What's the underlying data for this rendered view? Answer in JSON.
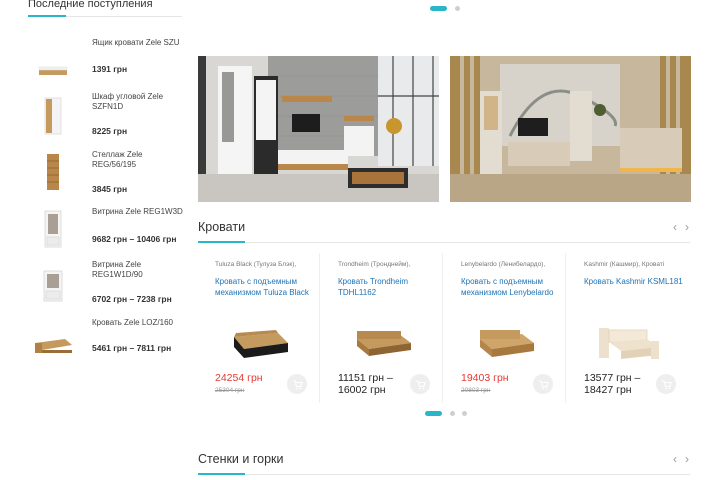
{
  "sidebar": {
    "title": "Последние поступления",
    "items": [
      {
        "name": "Ящик кровати Zele SZU",
        "price": "1391 грн",
        "thumb": "drawer"
      },
      {
        "name": "Шкаф угловой Zele SZFN1D",
        "price": "8225 грн",
        "thumb": "wardrobe"
      },
      {
        "name": "Стеллаж Zele REG/56/195",
        "price": "3845 грн",
        "thumb": "shelf"
      },
      {
        "name": "Витрина Zele REG1W3D",
        "price": "9682 грн – 10406 грн",
        "thumb": "vitrine"
      },
      {
        "name": "Витрина Zele REG1W1D/90",
        "price": "6702 грн – 7238 грн",
        "thumb": "vitrine-small"
      },
      {
        "name": "Кровать Zele LOZ/160",
        "price": "5461 грн – 7811 грн",
        "thumb": "bed"
      }
    ]
  },
  "colors": {
    "accent": "#29b6c9",
    "sale": "#e53935",
    "link": "#1f73b7"
  },
  "beds_section": {
    "title": "Кровати",
    "products": [
      {
        "category": "Tuluza Black (Тулуза Блэк),",
        "name": "Кровать с подъемным механизмом Tuluza Black",
        "price": "24254 грн",
        "old_price": "25304 грн",
        "on_sale": true
      },
      {
        "category": "Trondheim (Тронднейм),",
        "name": "Кровать Trondheim TDHL1162",
        "price": "11151 грн – 16002 грн",
        "old_price": "",
        "on_sale": false
      },
      {
        "category": "Lenybelardo (Ленибелардо),",
        "name": "Кровать с подъемным механизмом Lenybelardo",
        "price": "19403 грн",
        "old_price": "20803 грн",
        "on_sale": true
      },
      {
        "category": "Kashmir (Кашмир), Кроватi",
        "name": "Кровать Kashmir KSML181",
        "price": "13577 грн – 18427 грн",
        "old_price": "",
        "on_sale": false
      }
    ]
  },
  "walls_section": {
    "title": "Стенки и горки"
  },
  "icons": {
    "prev": "chevron-left-icon",
    "next": "chevron-right-icon",
    "cart": "cart-icon"
  }
}
